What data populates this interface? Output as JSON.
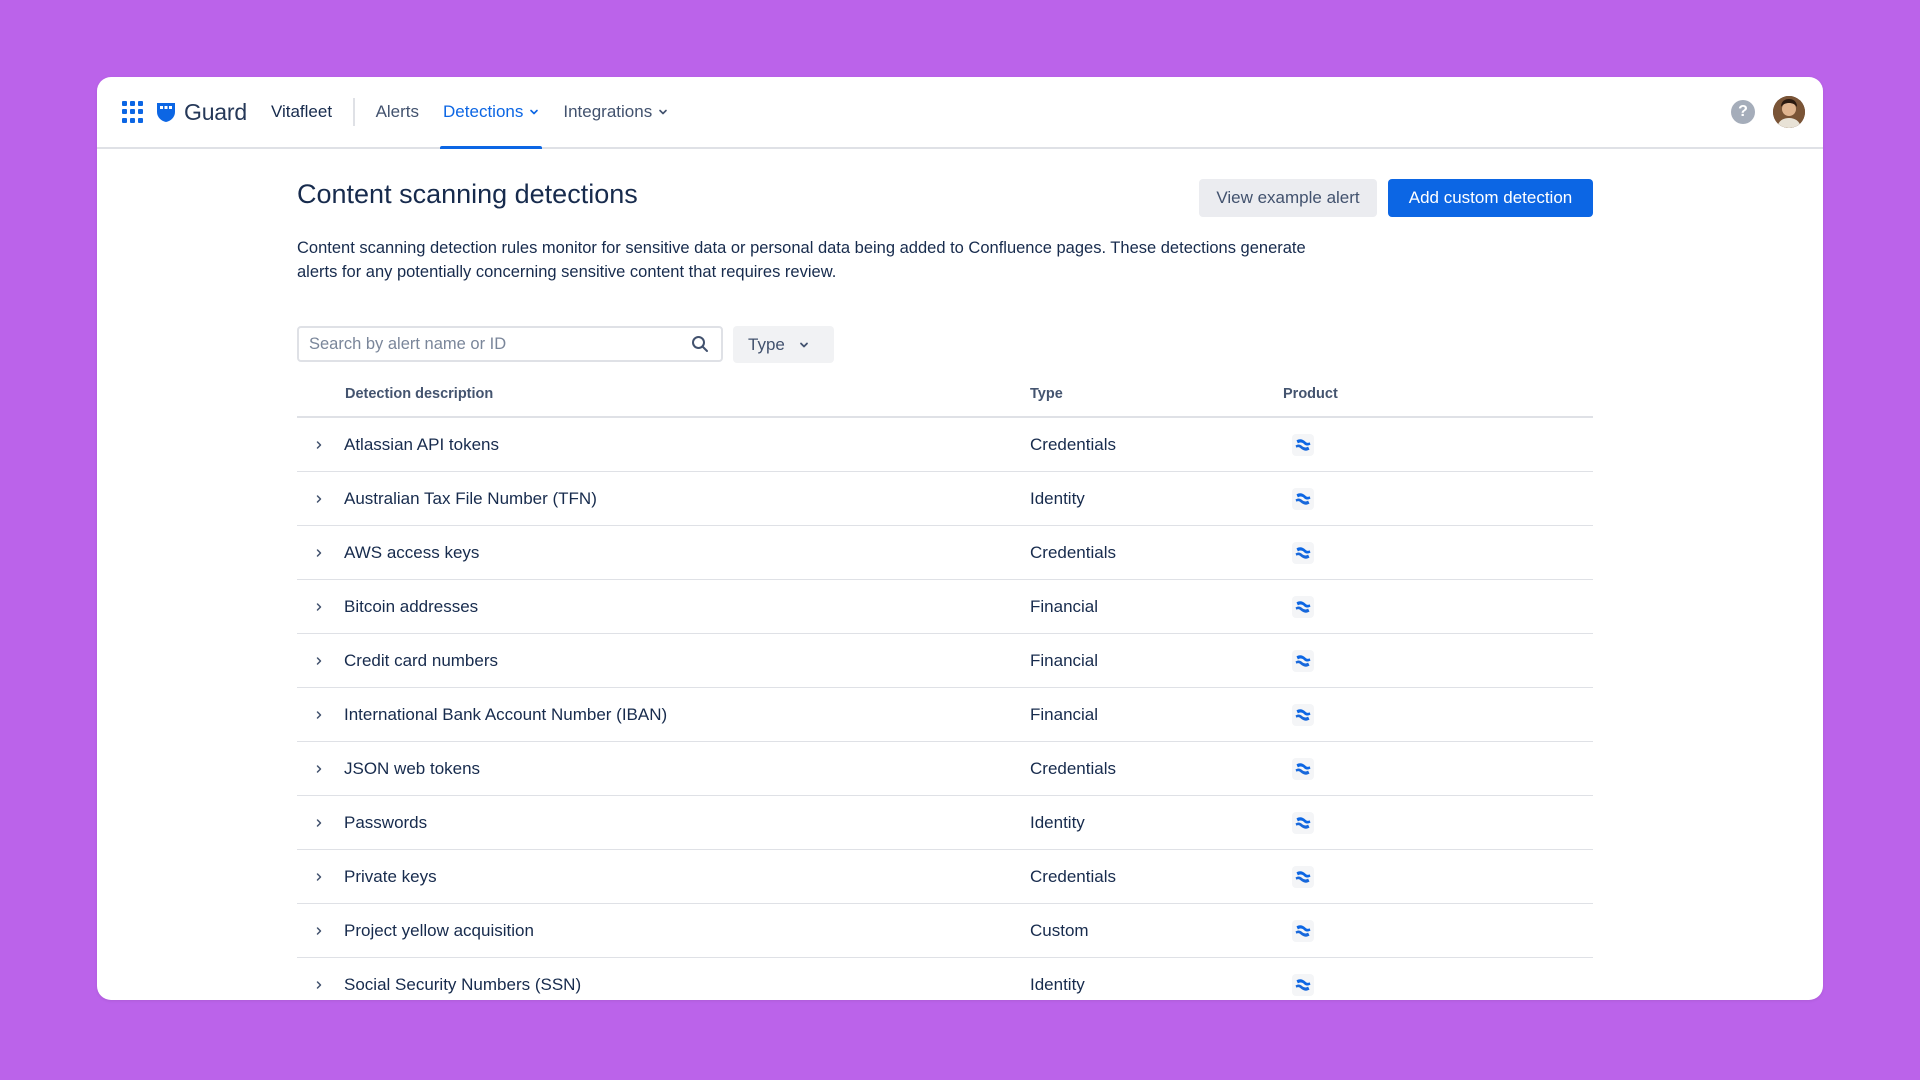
{
  "nav": {
    "brand": "Guard",
    "site": "Vitafleet",
    "items": [
      {
        "label": "Alerts",
        "active": false,
        "dropdown": false
      },
      {
        "label": "Detections",
        "active": true,
        "dropdown": true
      },
      {
        "label": "Integrations",
        "active": false,
        "dropdown": true
      }
    ],
    "help": "?"
  },
  "page": {
    "title": "Content scanning detections",
    "description": "Content scanning detection rules monitor for sensitive data or personal data being added to Confluence pages. These detections generate alerts for any potentially concerning sensitive content that requires review.",
    "view_example_label": "View example alert",
    "add_custom_label": "Add custom detection"
  },
  "search": {
    "placeholder": "Search by alert name or ID",
    "value": ""
  },
  "filter": {
    "type_label": "Type"
  },
  "table": {
    "headers": {
      "description": "Detection description",
      "type": "Type",
      "product": "Product"
    },
    "rows": [
      {
        "description": "Atlassian API tokens",
        "type": "Credentials",
        "product_icon": "confluence-icon"
      },
      {
        "description": "Australian Tax File Number (TFN)",
        "type": "Identity",
        "product_icon": "confluence-icon"
      },
      {
        "description": "AWS access keys",
        "type": "Credentials",
        "product_icon": "confluence-icon"
      },
      {
        "description": "Bitcoin addresses",
        "type": "Financial",
        "product_icon": "confluence-icon"
      },
      {
        "description": "Credit card numbers",
        "type": "Financial",
        "product_icon": "confluence-icon"
      },
      {
        "description": "International Bank Account Number (IBAN)",
        "type": "Financial",
        "product_icon": "confluence-icon"
      },
      {
        "description": "JSON web tokens",
        "type": "Credentials",
        "product_icon": "confluence-icon"
      },
      {
        "description": "Passwords",
        "type": "Identity",
        "product_icon": "confluence-icon"
      },
      {
        "description": "Private keys",
        "type": "Credentials",
        "product_icon": "confluence-icon"
      },
      {
        "description": "Project yellow acquisition",
        "type": "Custom",
        "product_icon": "confluence-icon"
      },
      {
        "description": "Social Security Numbers (SSN)",
        "type": "Identity",
        "product_icon": "confluence-icon"
      }
    ]
  },
  "colors": {
    "background": "#bb63ea",
    "primary": "#0c66e4",
    "text": "#172b4d",
    "border": "#dfe1e6"
  }
}
